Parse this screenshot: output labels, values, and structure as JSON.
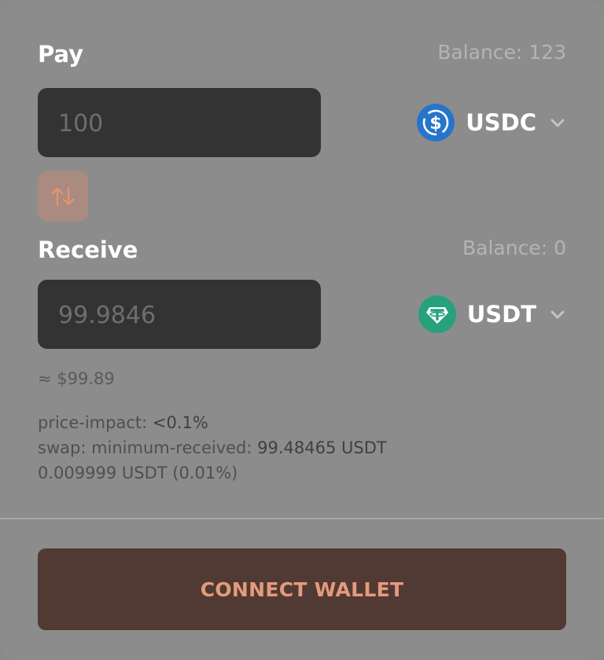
{
  "pay": {
    "label": "Pay",
    "balance": "Balance: 123",
    "amount_placeholder": "100",
    "token": {
      "symbol": "USDC",
      "icon": "usdc-icon",
      "color": "#2775ca"
    }
  },
  "swap_direction": {
    "icon": "swap-arrows-icon",
    "color": "#e6936f"
  },
  "receive": {
    "label": "Receive",
    "balance": "Balance: 0",
    "amount_placeholder": "99.9846",
    "token": {
      "symbol": "USDT",
      "icon": "usdt-icon",
      "color": "#26a17b"
    }
  },
  "usd_estimate": "≈ $99.89",
  "details": {
    "price_impact_label": "price-impact:",
    "price_impact_value": "<0.1%",
    "min_received_label": "swap: minimum-received:",
    "min_received_value": "99.48465 USDT",
    "fee": "0.009999 USDT (0.01%)"
  },
  "connect_button": {
    "label": "CONNECT WALLET"
  },
  "colors": {
    "background": "#8c8c8c",
    "input_bg": "#333333",
    "accent": "#e49a7d",
    "button_bg": "#513a33"
  }
}
